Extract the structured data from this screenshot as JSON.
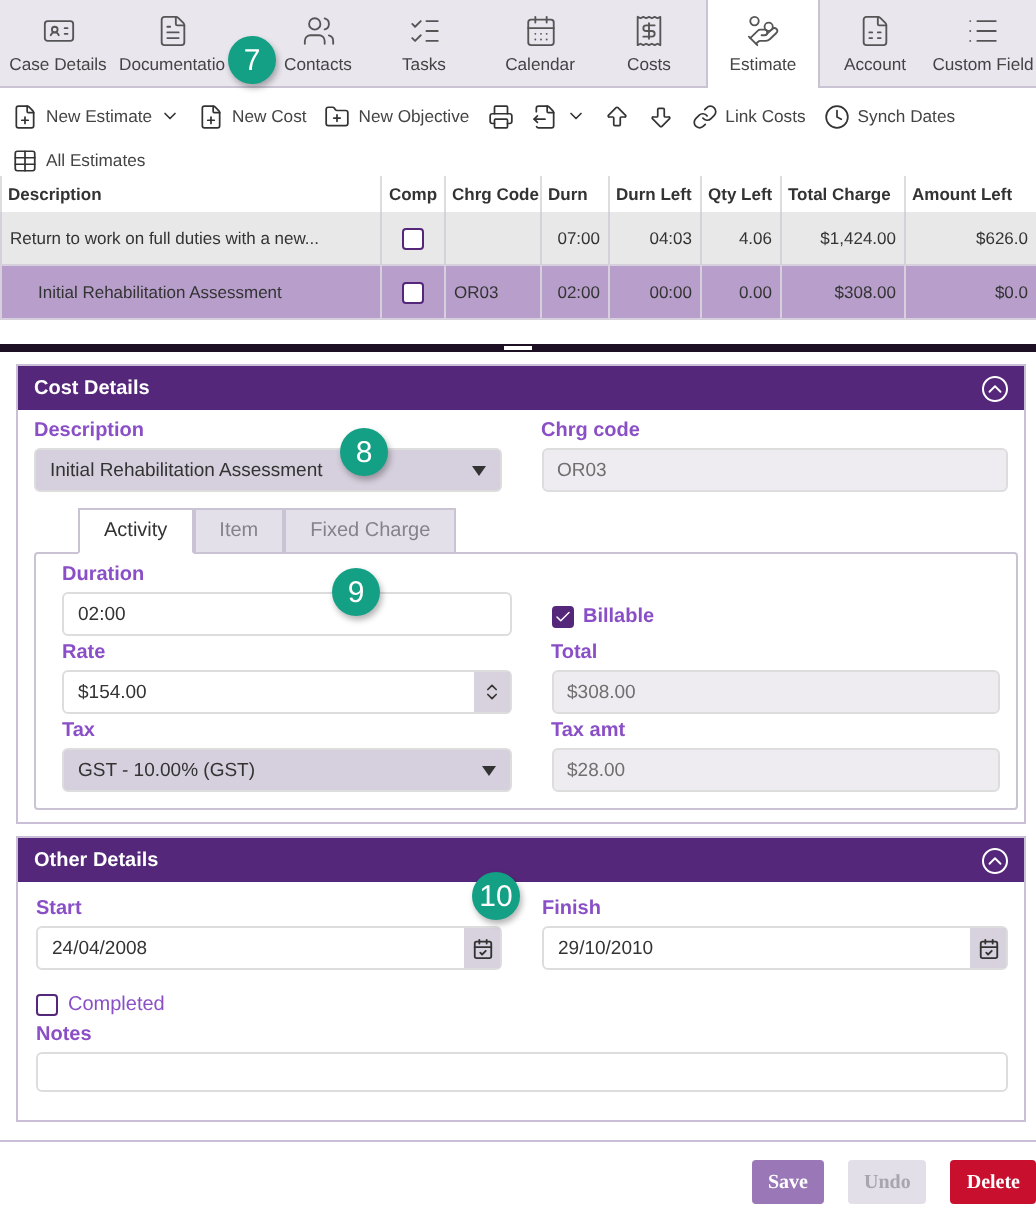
{
  "tabs": [
    {
      "label": "Case Details",
      "selected": false
    },
    {
      "label": "Documentatio",
      "selected": false
    },
    {
      "label": "Contacts",
      "selected": false
    },
    {
      "label": "Tasks",
      "selected": false
    },
    {
      "label": "Calendar",
      "selected": false
    },
    {
      "label": "Costs",
      "selected": false
    },
    {
      "label": "Estimate",
      "selected": true
    },
    {
      "label": "Account",
      "selected": false
    },
    {
      "label": "Custom Field",
      "selected": false
    }
  ],
  "toolbar": [
    {
      "label": "New Estimate",
      "menu": true
    },
    {
      "label": "New Cost",
      "menu": false
    },
    {
      "label": "New Objective",
      "menu": false
    },
    {
      "menu": false
    },
    {
      "menu": true
    },
    {
      "menu": false
    },
    {
      "menu": false
    },
    {
      "label": "Link Costs",
      "menu": false
    },
    {
      "label": "Synch Dates",
      "menu": false
    },
    {
      "label": "All Estimates",
      "menu": false
    }
  ],
  "table": {
    "columns": [
      "Description",
      "Comp",
      "Chrg Code",
      "Durn",
      "Durn Left",
      "Qty Left",
      "Total Charge",
      "Amount Left"
    ],
    "rows": [
      {
        "comp": false,
        "selected": false,
        "cells": [
          "Return to work on full duties with a new...",
          "",
          "",
          "07:00",
          "04:03",
          "4.06",
          "$1,424.00",
          "$626.0"
        ],
        "children": [
          {
            "comp": false,
            "selected": true,
            "cells": [
              "Initial Rehabilitation Assessment",
              "",
              "OR03",
              "02:00",
              "00:00",
              "0.00",
              "$308.00",
              "$0.0"
            ]
          }
        ]
      }
    ]
  },
  "cost_details": {
    "title": "Cost Details",
    "expanded": true,
    "description": {
      "label": "Description",
      "value": "Initial Rehabilitation Assessment"
    },
    "chrg_code": {
      "label": "Chrg code",
      "value": "OR03"
    },
    "tabs": [
      {
        "label": "Activity",
        "selected": true,
        "disabled": false
      },
      {
        "label": "Item",
        "selected": false,
        "disabled": true
      },
      {
        "label": "Fixed Charge",
        "selected": false,
        "disabled": true
      }
    ],
    "duration": {
      "label": "Duration",
      "value": "02:00"
    },
    "billable": {
      "label": "Billable",
      "checked": true
    },
    "rate": {
      "label": "Rate",
      "value": "$154.00"
    },
    "total": {
      "label": "Total",
      "value": "$308.00"
    },
    "tax": {
      "label": "Tax",
      "value": "GST - 10.00% (GST)"
    },
    "tax_amt": {
      "label": "Tax amt",
      "value": "$28.00"
    }
  },
  "other_details": {
    "title": "Other Details",
    "expanded": true,
    "start": {
      "label": "Start",
      "value": "24/04/2008"
    },
    "finish": {
      "label": "Finish",
      "value": "29/10/2010"
    },
    "completed": {
      "label": "Completed",
      "checked": false
    },
    "notes": {
      "label": "Notes"
    }
  },
  "buttons": [
    {
      "label": "Save",
      "kind": "primary",
      "disabled": false
    },
    {
      "label": "Undo",
      "kind": "secondary",
      "disabled": true
    },
    {
      "label": "Delete",
      "kind": "danger",
      "disabled": false
    }
  ],
  "callouts": [
    "7",
    "8",
    "9",
    "10"
  ]
}
